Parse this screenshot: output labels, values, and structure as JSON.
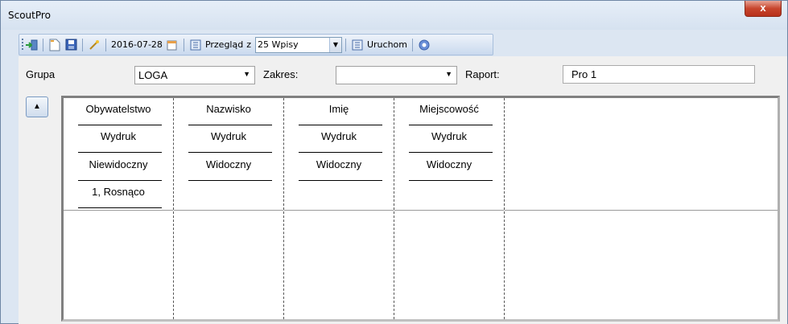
{
  "window": {
    "title": "ScoutPro",
    "close_glyph": "x"
  },
  "toolbar": {
    "date": "2016-07-28",
    "preview_label": "Przegląd",
    "z_label": "z",
    "entries_value": "25 Wpisy",
    "run_label": "Uruchom"
  },
  "filters": {
    "group_label": "Grupa",
    "group_value": "LOGA",
    "range_label": "Zakres:",
    "range_value": "",
    "report_label": "Raport:",
    "report_value": "Pro 1"
  },
  "up_button_glyph": "▲",
  "columns": [
    {
      "title": "Obywatelstwo",
      "print": "Wydruk",
      "visibility": "Niewidoczny",
      "sort": "1, Rosnąco"
    },
    {
      "title": "Nazwisko",
      "print": "Wydruk",
      "visibility": "Widoczny",
      "sort": ""
    },
    {
      "title": "Imię",
      "print": "Wydruk",
      "visibility": "Widoczny",
      "sort": ""
    },
    {
      "title": "Miejscowość",
      "print": "Wydruk",
      "visibility": "Widoczny",
      "sort": ""
    }
  ]
}
